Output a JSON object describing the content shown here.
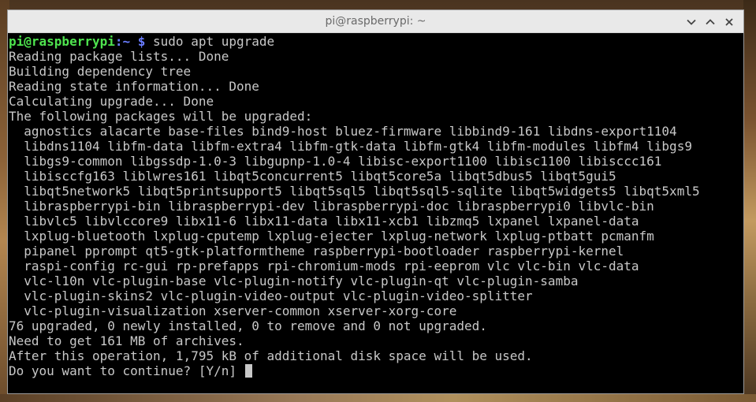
{
  "window": {
    "title": "pi@raspberrypi: ~"
  },
  "prompt": {
    "user_host": "pi@raspberrypi",
    "path": ":~ $",
    "command": " sudo apt upgrade"
  },
  "output_lines": [
    "Reading package lists... Done",
    "Building dependency tree",
    "Reading state information... Done",
    "Calculating upgrade... Done",
    "The following packages will be upgraded:",
    "  agnostics alacarte base-files bind9-host bluez-firmware libbind9-161 libdns-export1104",
    "  libdns1104 libfm-data libfm-extra4 libfm-gtk-data libfm-gtk4 libfm-modules libfm4 libgs9",
    "  libgs9-common libgssdp-1.0-3 libgupnp-1.0-4 libisc-export1100 libisc1100 libisccc161",
    "  libisccfg163 liblwres161 libqt5concurrent5 libqt5core5a libqt5dbus5 libqt5gui5",
    "  libqt5network5 libqt5printsupport5 libqt5sql5 libqt5sql5-sqlite libqt5widgets5 libqt5xml5",
    "  libraspberrypi-bin libraspberrypi-dev libraspberrypi-doc libraspberrypi0 libvlc-bin",
    "  libvlc5 libvlccore9 libx11-6 libx11-data libx11-xcb1 libzmq5 lxpanel lxpanel-data",
    "  lxplug-bluetooth lxplug-cputemp lxplug-ejecter lxplug-network lxplug-ptbatt pcmanfm",
    "  pipanel pprompt qt5-gtk-platformtheme raspberrypi-bootloader raspberrypi-kernel",
    "  raspi-config rc-gui rp-prefapps rpi-chromium-mods rpi-eeprom vlc vlc-bin vlc-data",
    "  vlc-l10n vlc-plugin-base vlc-plugin-notify vlc-plugin-qt vlc-plugin-samba",
    "  vlc-plugin-skins2 vlc-plugin-video-output vlc-plugin-video-splitter",
    "  vlc-plugin-visualization xserver-common xserver-xorg-core",
    "76 upgraded, 0 newly installed, 0 to remove and 0 not upgraded.",
    "Need to get 161 MB of archives.",
    "After this operation, 1,795 kB of additional disk space will be used."
  ],
  "question": "Do you want to continue? [Y/n] ",
  "icons": {
    "minimize": "chevron-down-icon",
    "maximize": "chevron-up-icon",
    "close": "close-icon"
  }
}
